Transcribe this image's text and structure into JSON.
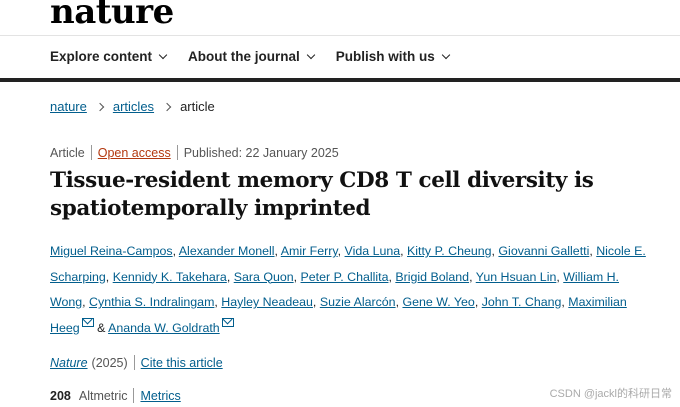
{
  "header": {
    "logo": "nature"
  },
  "nav": [
    {
      "label": "Explore content"
    },
    {
      "label": "About the journal"
    },
    {
      "label": "Publish with us"
    }
  ],
  "breadcrumb": [
    "nature",
    "articles",
    "article"
  ],
  "meta": {
    "type": "Article",
    "access": "Open access",
    "published": "Published: 22 January 2025"
  },
  "article": {
    "title": "Tissue-resident memory CD8 T cell diversity is spatiotemporally imprinted",
    "authors": [
      "Miguel Reina-Campos",
      "Alexander Monell",
      "Amir Ferry",
      "Vida Luna",
      "Kitty P. Cheung",
      "Giovanni Galletti",
      "Nicole E. Scharping",
      "Kennidy K. Takehara",
      "Sara Quon",
      "Peter P. Challita",
      "Brigid Boland",
      "Yun Hsuan Lin",
      "William H. Wong",
      "Cynthia S. Indralingam",
      "Hayley Neadeau",
      "Suzie Alarcón",
      "Gene W. Yeo",
      "John T. Chang",
      "Maximilian Heeg",
      "Ananda W. Goldrath"
    ],
    "author_conjunction": "&"
  },
  "citation": {
    "journal": "Nature",
    "year": "(2025)",
    "cite_label": "Cite this article"
  },
  "metrics": {
    "altmetric_score": "208",
    "altmetric_label": "Altmetric",
    "metrics_label": "Metrics"
  },
  "watermark": "CSDN @jackl的科研日常",
  "colors": {
    "link": "#025e8d",
    "open_access": "#b3380f",
    "nav_bar": "#222222"
  }
}
